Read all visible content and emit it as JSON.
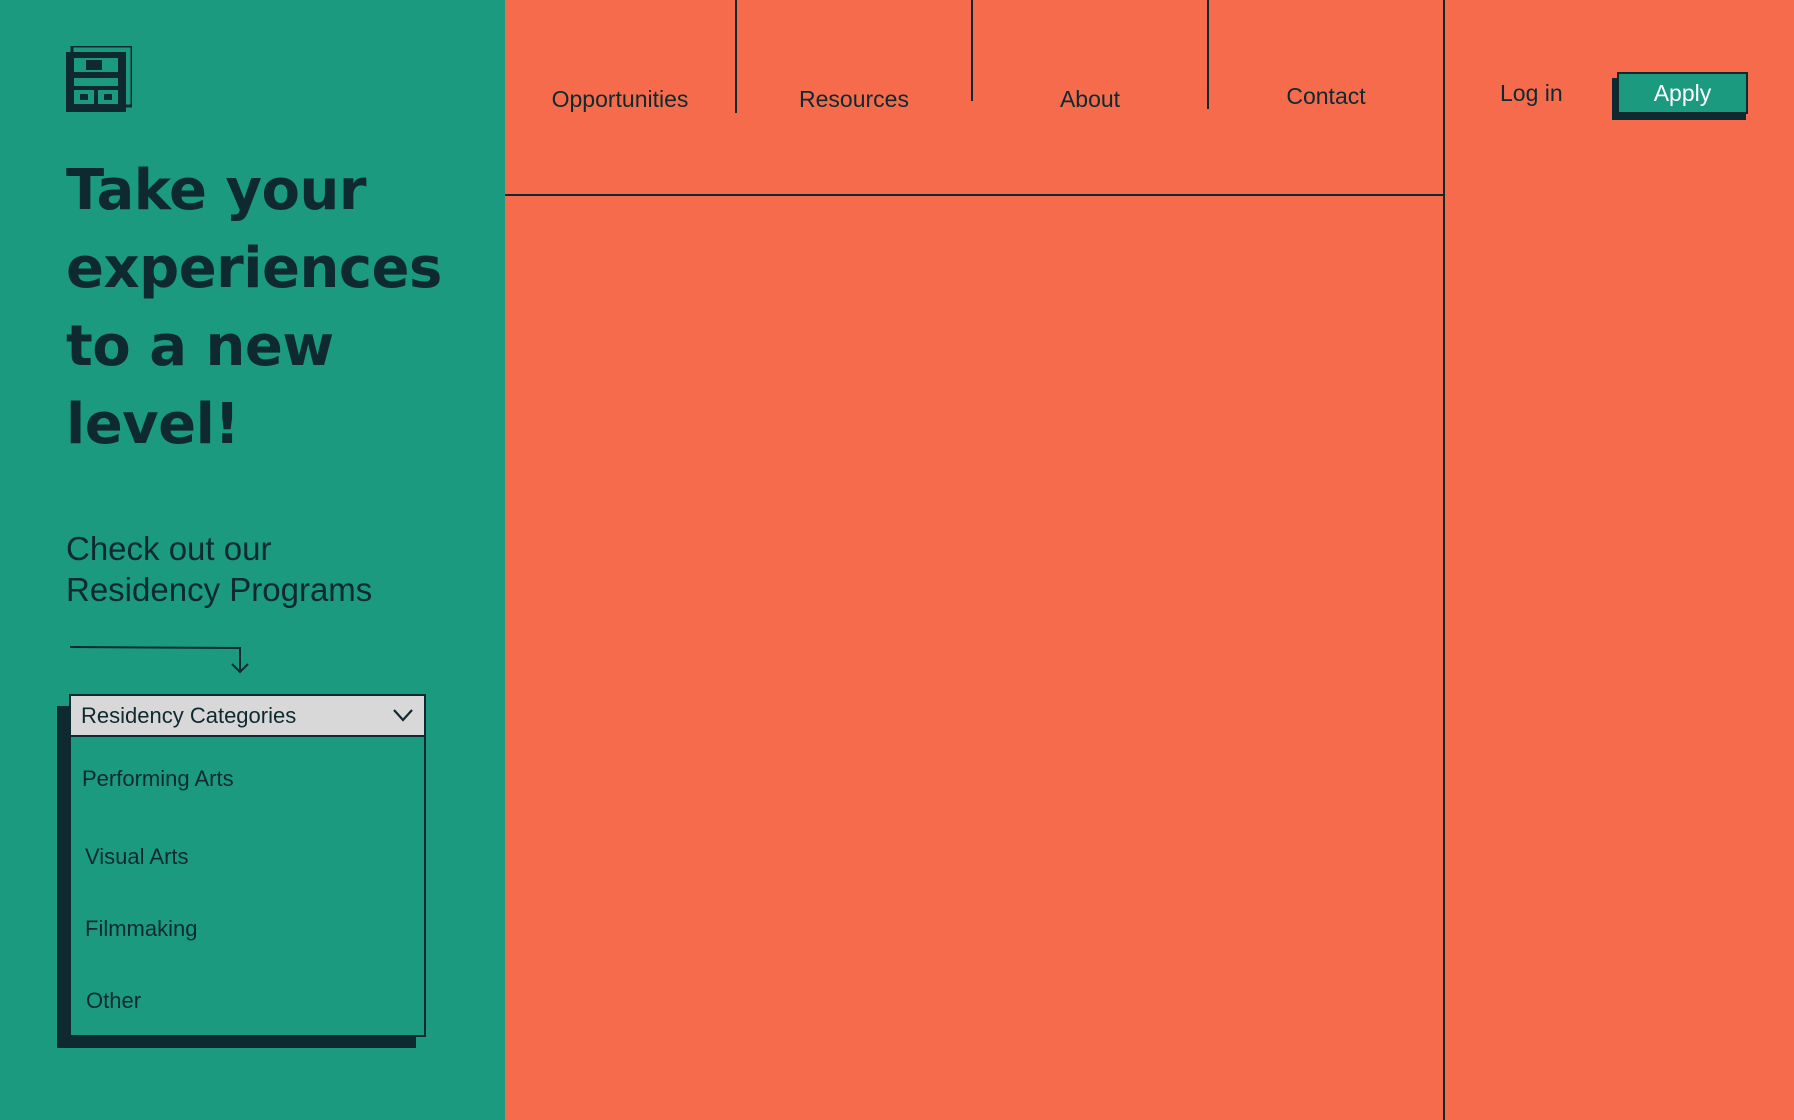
{
  "colors": {
    "left_panel": "#1b9a80",
    "right_panel": "#f56b4b",
    "ink": "#0e2a30",
    "select_bg": "#d8d8d8",
    "apply_text": "#ffffff"
  },
  "logo": {
    "icon": "brand-logo-icon"
  },
  "hero": {
    "headline_lines": [
      "Take your",
      "experiences",
      "to a new",
      "level!"
    ],
    "subhead_lines": [
      "Check out our",
      "Residency Programs"
    ],
    "arrow_icon": "arrow-down-icon"
  },
  "dropdown": {
    "selected": "Residency Categories",
    "chevron_icon": "chevron-down-icon",
    "options": [
      "Performing Arts",
      "Visual Arts",
      "Filmmaking",
      "Other"
    ]
  },
  "nav": {
    "items": [
      "Opportunities",
      "Resources",
      "About",
      "Contact"
    ],
    "login_label": "Log in",
    "apply_label": "Apply"
  }
}
